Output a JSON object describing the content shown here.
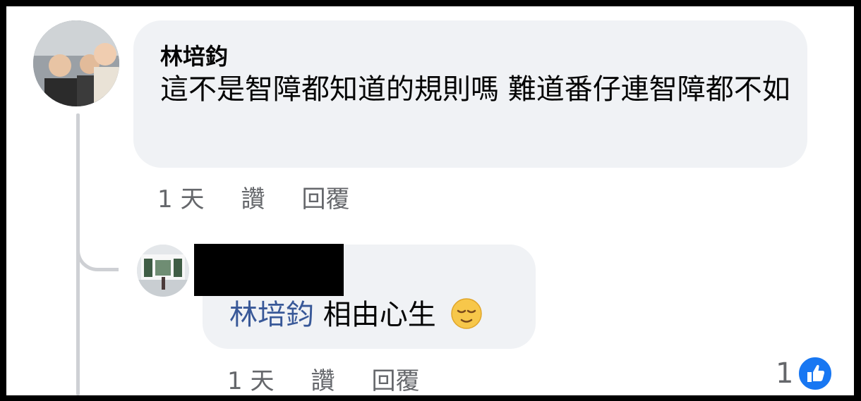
{
  "comment": {
    "author": "林培鈞",
    "text": "這不是智障都知道的規則嗎 難道番仔連智障都不如",
    "timestamp": "1 天",
    "like_label": "讚",
    "reply_label": "回覆"
  },
  "reply": {
    "mention": "林培鈞",
    "text": "相由心生",
    "emoji": "pensive-face",
    "timestamp": "1 天",
    "like_label": "讚",
    "reply_label": "回覆",
    "reaction_count": "1",
    "reaction_type": "like"
  },
  "colors": {
    "bubble": "#f0f2f5",
    "mention": "#385898",
    "like_badge": "#1877f2",
    "meta_text": "#65676b"
  }
}
